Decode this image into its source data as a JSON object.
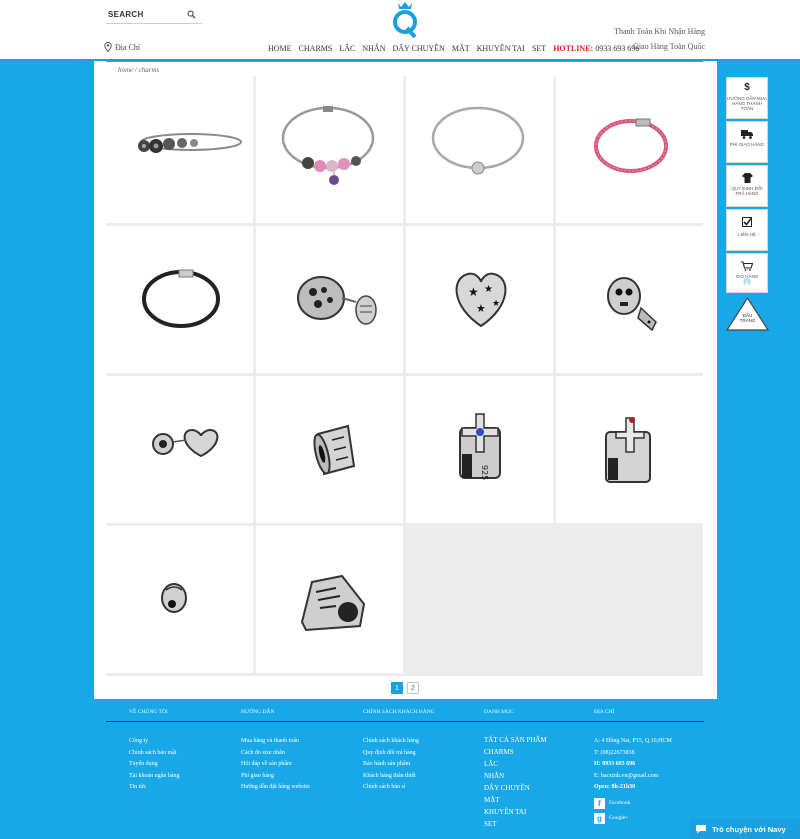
{
  "header": {
    "search_label": "SEARCH",
    "address_label": "Địa Chỉ",
    "nav": [
      "HOME",
      "CHARMS",
      "LẮC",
      "NHẪN",
      "DÂY CHUYỀN",
      "MẶT",
      "KHUYÊN TAI",
      "SET"
    ],
    "hotline_label": "HOTLINE:",
    "hotline_number": "0933 693 696",
    "right_line1": "Thanh Toán Khi Nhận Hàng",
    "right_line2": "Giao Hàng Toàn Quốc"
  },
  "breadcrumb": "home / charms",
  "products": [
    {
      "name": "charm-bracelet-1"
    },
    {
      "name": "charm-bracelet-2"
    },
    {
      "name": "bangle-silver"
    },
    {
      "name": "pink-leather-bracelet"
    },
    {
      "name": "black-leather-bracelet"
    },
    {
      "name": "fish-charm"
    },
    {
      "name": "star-heart-charm"
    },
    {
      "name": "skull-charm"
    },
    {
      "name": "heart-lock-charm"
    },
    {
      "name": "engraved-barrel-charm"
    },
    {
      "name": "cross-blue-stone-charm"
    },
    {
      "name": "gift-box-cross-charm"
    },
    {
      "name": "small-bead-charm"
    },
    {
      "name": "shoe-charm"
    }
  ],
  "pagination": [
    "1",
    "2"
  ],
  "sidebar": [
    {
      "icon": "dollar-icon",
      "glyph": "$",
      "label": "Hướng dẫn mua hàng thanh toán"
    },
    {
      "icon": "truck-icon",
      "glyph": "▬",
      "label": "Phí giao hàng"
    },
    {
      "icon": "shirt-icon",
      "glyph": "▼",
      "label": "Quy định đổi trả hàng"
    },
    {
      "icon": "checkbox-icon",
      "glyph": "☑",
      "label": "Liên hệ"
    },
    {
      "icon": "cart-icon",
      "glyph": "🛒",
      "label": "Giỏ hàng",
      "count": "(0)"
    }
  ],
  "back_to_top": "ĐẦU TRANG",
  "footer": {
    "col1": {
      "title": "Về chúng tôi",
      "items": [
        "Công ty",
        "Chính sách bảo mật",
        "Tuyển dụng",
        "Tài khoản ngân hàng",
        "Tin tức"
      ]
    },
    "col2": {
      "title": "Hướng dẫn",
      "items": [
        "Mua hàng và thanh toán",
        "Cách đo size nhẫn",
        "Hỏi đáp về sản phẩm",
        "Phí giao hàng",
        "Hướng dẫn đặt hàng website"
      ]
    },
    "col3": {
      "title": "Chính sách khách hàng",
      "items": [
        "Chính sách khách hàng",
        "Quy định đổi trả hàng",
        "Bảo hành sản phẩm",
        "Khách hàng thân thiết",
        "Chính sách bán sỉ"
      ]
    },
    "col4": {
      "title": "Danh mục",
      "items": [
        "TẤT CẢ SẢN PHẨM",
        "CHARMS",
        "LẮC",
        "NHẪN",
        "DÂY CHUYỀN",
        "MẶT",
        "KHUYÊN TAI",
        "SET"
      ]
    },
    "col5": {
      "title": "Địa chỉ",
      "address": "A: 4 Đồng Nai, P15, Q.10,HCM",
      "tel": "T: (08)22673838",
      "hotline": "H: 0933 693 696",
      "email": "E: bacxinh.vn@gmail.com",
      "open": "Open: 8h-21h30",
      "facebook": "Facebook",
      "google": "Google+"
    }
  },
  "chat_label": "Trò chuyện với Navy",
  "colors": {
    "brand_blue": "#1a9fe0",
    "hotline_red": "#e02020"
  }
}
